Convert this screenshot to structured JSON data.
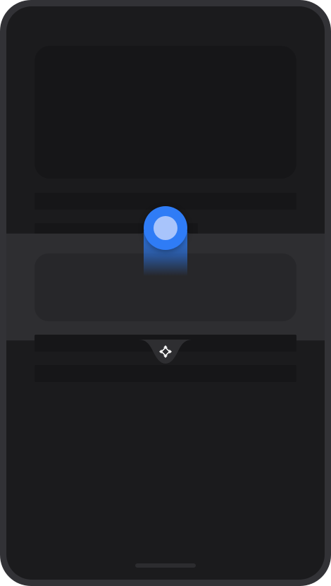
{
  "device": {
    "frame_color": "#323236",
    "screen_color": "#1b1b1d"
  },
  "content": {
    "placeholder_color": "#161618"
  },
  "band": {
    "background": "#2e2e31",
    "card_color": "#27272a"
  },
  "handle": {
    "knob_color": "#2f7cf6",
    "knob_inner_color": "#a8c4fb",
    "icon": "move-arrows-icon",
    "knob_icon": "drag-knob-icon"
  }
}
